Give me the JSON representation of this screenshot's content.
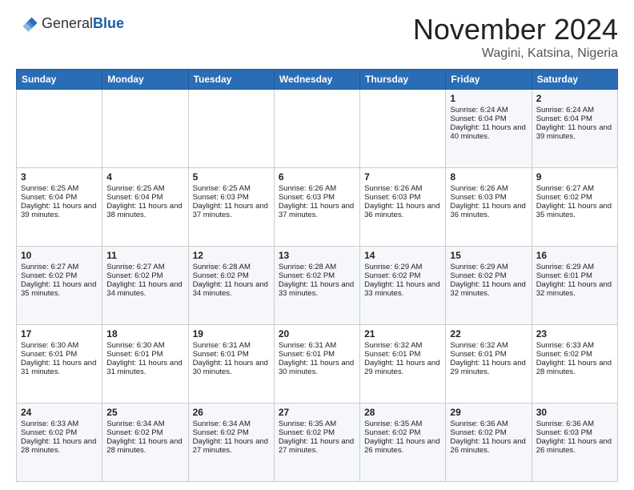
{
  "header": {
    "logo_line1": "General",
    "logo_line2": "Blue",
    "month_title": "November 2024",
    "location": "Wagini, Katsina, Nigeria"
  },
  "days_of_week": [
    "Sunday",
    "Monday",
    "Tuesday",
    "Wednesday",
    "Thursday",
    "Friday",
    "Saturday"
  ],
  "weeks": [
    [
      {
        "day": "",
        "info": ""
      },
      {
        "day": "",
        "info": ""
      },
      {
        "day": "",
        "info": ""
      },
      {
        "day": "",
        "info": ""
      },
      {
        "day": "",
        "info": ""
      },
      {
        "day": "1",
        "info": "Sunrise: 6:24 AM\nSunset: 6:04 PM\nDaylight: 11 hours and 40 minutes."
      },
      {
        "day": "2",
        "info": "Sunrise: 6:24 AM\nSunset: 6:04 PM\nDaylight: 11 hours and 39 minutes."
      }
    ],
    [
      {
        "day": "3",
        "info": "Sunrise: 6:25 AM\nSunset: 6:04 PM\nDaylight: 11 hours and 39 minutes."
      },
      {
        "day": "4",
        "info": "Sunrise: 6:25 AM\nSunset: 6:04 PM\nDaylight: 11 hours and 38 minutes."
      },
      {
        "day": "5",
        "info": "Sunrise: 6:25 AM\nSunset: 6:03 PM\nDaylight: 11 hours and 37 minutes."
      },
      {
        "day": "6",
        "info": "Sunrise: 6:26 AM\nSunset: 6:03 PM\nDaylight: 11 hours and 37 minutes."
      },
      {
        "day": "7",
        "info": "Sunrise: 6:26 AM\nSunset: 6:03 PM\nDaylight: 11 hours and 36 minutes."
      },
      {
        "day": "8",
        "info": "Sunrise: 6:26 AM\nSunset: 6:03 PM\nDaylight: 11 hours and 36 minutes."
      },
      {
        "day": "9",
        "info": "Sunrise: 6:27 AM\nSunset: 6:02 PM\nDaylight: 11 hours and 35 minutes."
      }
    ],
    [
      {
        "day": "10",
        "info": "Sunrise: 6:27 AM\nSunset: 6:02 PM\nDaylight: 11 hours and 35 minutes."
      },
      {
        "day": "11",
        "info": "Sunrise: 6:27 AM\nSunset: 6:02 PM\nDaylight: 11 hours and 34 minutes."
      },
      {
        "day": "12",
        "info": "Sunrise: 6:28 AM\nSunset: 6:02 PM\nDaylight: 11 hours and 34 minutes."
      },
      {
        "day": "13",
        "info": "Sunrise: 6:28 AM\nSunset: 6:02 PM\nDaylight: 11 hours and 33 minutes."
      },
      {
        "day": "14",
        "info": "Sunrise: 6:29 AM\nSunset: 6:02 PM\nDaylight: 11 hours and 33 minutes."
      },
      {
        "day": "15",
        "info": "Sunrise: 6:29 AM\nSunset: 6:02 PM\nDaylight: 11 hours and 32 minutes."
      },
      {
        "day": "16",
        "info": "Sunrise: 6:29 AM\nSunset: 6:01 PM\nDaylight: 11 hours and 32 minutes."
      }
    ],
    [
      {
        "day": "17",
        "info": "Sunrise: 6:30 AM\nSunset: 6:01 PM\nDaylight: 11 hours and 31 minutes."
      },
      {
        "day": "18",
        "info": "Sunrise: 6:30 AM\nSunset: 6:01 PM\nDaylight: 11 hours and 31 minutes."
      },
      {
        "day": "19",
        "info": "Sunrise: 6:31 AM\nSunset: 6:01 PM\nDaylight: 11 hours and 30 minutes."
      },
      {
        "day": "20",
        "info": "Sunrise: 6:31 AM\nSunset: 6:01 PM\nDaylight: 11 hours and 30 minutes."
      },
      {
        "day": "21",
        "info": "Sunrise: 6:32 AM\nSunset: 6:01 PM\nDaylight: 11 hours and 29 minutes."
      },
      {
        "day": "22",
        "info": "Sunrise: 6:32 AM\nSunset: 6:01 PM\nDaylight: 11 hours and 29 minutes."
      },
      {
        "day": "23",
        "info": "Sunrise: 6:33 AM\nSunset: 6:02 PM\nDaylight: 11 hours and 28 minutes."
      }
    ],
    [
      {
        "day": "24",
        "info": "Sunrise: 6:33 AM\nSunset: 6:02 PM\nDaylight: 11 hours and 28 minutes."
      },
      {
        "day": "25",
        "info": "Sunrise: 6:34 AM\nSunset: 6:02 PM\nDaylight: 11 hours and 28 minutes."
      },
      {
        "day": "26",
        "info": "Sunrise: 6:34 AM\nSunset: 6:02 PM\nDaylight: 11 hours and 27 minutes."
      },
      {
        "day": "27",
        "info": "Sunrise: 6:35 AM\nSunset: 6:02 PM\nDaylight: 11 hours and 27 minutes."
      },
      {
        "day": "28",
        "info": "Sunrise: 6:35 AM\nSunset: 6:02 PM\nDaylight: 11 hours and 26 minutes."
      },
      {
        "day": "29",
        "info": "Sunrise: 6:36 AM\nSunset: 6:02 PM\nDaylight: 11 hours and 26 minutes."
      },
      {
        "day": "30",
        "info": "Sunrise: 6:36 AM\nSunset: 6:03 PM\nDaylight: 11 hours and 26 minutes."
      }
    ]
  ]
}
